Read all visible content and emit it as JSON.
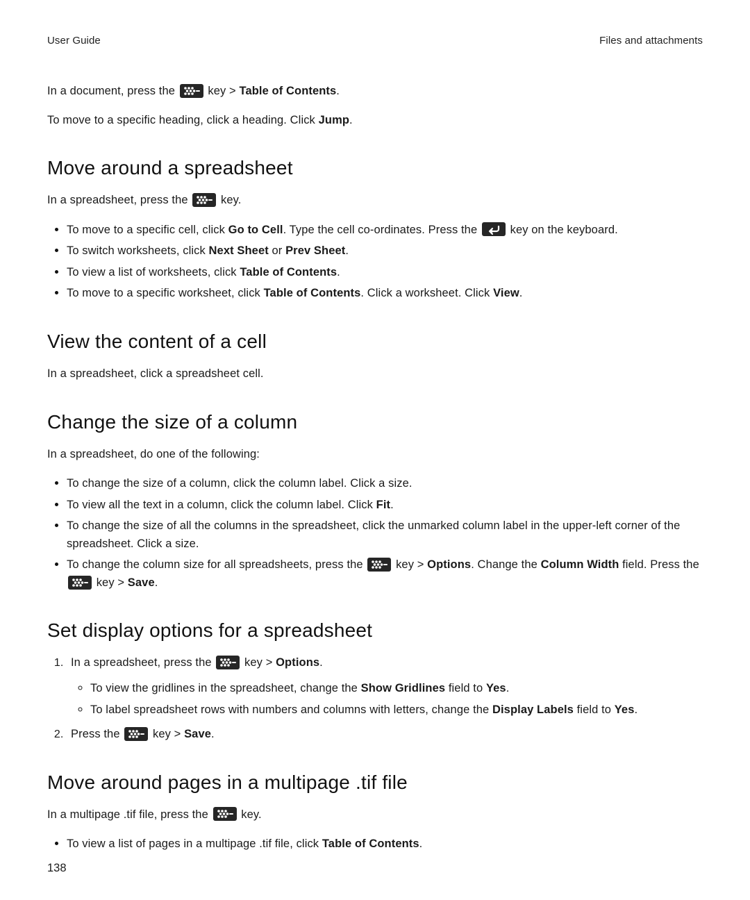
{
  "header": {
    "left": "User Guide",
    "right": "Files and attachments"
  },
  "intro": {
    "line1_pre": "In a document, press the ",
    "line1_mid": " key > ",
    "line1_bold": "Table of Contents",
    "line1_post": ".",
    "line2_pre": "To move to a specific heading, click a heading. Click ",
    "line2_bold": "Jump",
    "line2_post": "."
  },
  "sec_spreadsheet": {
    "heading": "Move around a spreadsheet",
    "p_pre": "In a spreadsheet, press the ",
    "p_post": " key.",
    "b1_pre": "To move to a specific cell, click ",
    "b1_bold1": "Go to Cell",
    "b1_mid": ". Type the cell co-ordinates. Press the ",
    "b1_post": " key on the keyboard.",
    "b2_pre": "To switch worksheets, click ",
    "b2_bold1": "Next Sheet",
    "b2_or": " or ",
    "b2_bold2": "Prev Sheet",
    "b2_post": ".",
    "b3_pre": "To view a list of worksheets, click ",
    "b3_bold": "Table of Contents",
    "b3_post": ".",
    "b4_pre": "To move to a specific worksheet, click ",
    "b4_bold1": "Table of Contents",
    "b4_mid": ". Click a worksheet. Click ",
    "b4_bold2": "View",
    "b4_post": "."
  },
  "sec_viewcell": {
    "heading": "View the content of a cell",
    "p": "In a spreadsheet, click a spreadsheet cell."
  },
  "sec_column": {
    "heading": "Change the size of a column",
    "p": "In a spreadsheet, do one of the following:",
    "b1": "To change the size of a column, click the column label. Click a size.",
    "b2_pre": "To view all the text in a column, click the column label. Click ",
    "b2_bold": "Fit",
    "b2_post": ".",
    "b3": "To change the size of all the columns in the spreadsheet, click the unmarked column label in the upper-left corner of the spreadsheet. Click a size.",
    "b4_pre": "To change the column size for all spreadsheets, press the ",
    "b4_mid1": " key > ",
    "b4_bold1": "Options",
    "b4_mid2": ". Change the ",
    "b4_bold2": "Column Width",
    "b4_mid3": " field. Press the ",
    "b4_mid4": " key > ",
    "b4_bold3": "Save",
    "b4_post": "."
  },
  "sec_display": {
    "heading": "Set display options for a spreadsheet",
    "s1_pre": "In a spreadsheet, press the ",
    "s1_mid": " key > ",
    "s1_bold": "Options",
    "s1_post": ".",
    "s1a_pre": "To view the gridlines in the spreadsheet, change the ",
    "s1a_bold1": "Show Gridlines",
    "s1a_mid": " field to ",
    "s1a_bold2": "Yes",
    "s1a_post": ".",
    "s1b_pre": "To label spreadsheet rows with numbers and columns with letters, change the ",
    "s1b_bold1": "Display Labels",
    "s1b_mid": " field to ",
    "s1b_bold2": "Yes",
    "s1b_post": ".",
    "s2_pre": "Press the ",
    "s2_mid": " key > ",
    "s2_bold": "Save",
    "s2_post": "."
  },
  "sec_tif": {
    "heading": "Move around pages in a multipage .tif file",
    "p_pre": "In a multipage .tif file, press the ",
    "p_post": " key.",
    "b1_pre": "To view a list of pages in a multipage .tif file, click ",
    "b1_bold": "Table of Contents",
    "b1_post": "."
  },
  "page_number": "138"
}
